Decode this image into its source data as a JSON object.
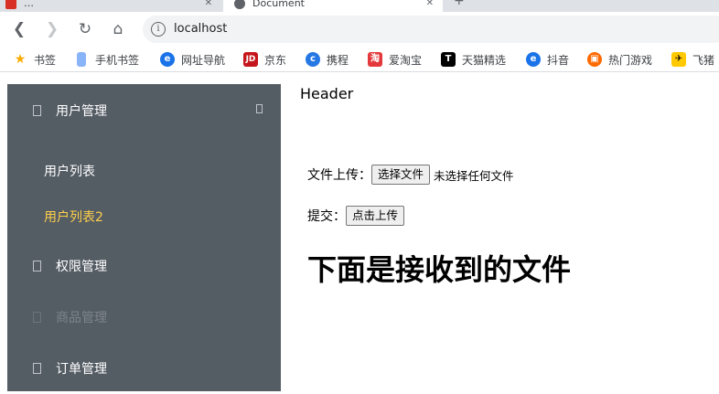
{
  "browser": {
    "tabs": [
      {
        "title": "…"
      },
      {
        "title": "Document"
      }
    ],
    "omnibox": {
      "url": "localhost"
    },
    "bookmarks": [
      {
        "label": "书签",
        "icon": "star-icon",
        "color": "#f9ab00"
      },
      {
        "label": "手机书签",
        "icon": "phone-icon",
        "color": "#8ab4f8"
      },
      {
        "label": "网址导航",
        "icon": "e-browser-icon",
        "color": "#1a73e8"
      },
      {
        "label": "京东",
        "icon": "jd-logo-icon",
        "color": "#c4161c"
      },
      {
        "label": "携程",
        "icon": "ctrip-logo-icon",
        "color": "#2577e3"
      },
      {
        "label": "爱淘宝",
        "icon": "taobao-logo-icon",
        "color": "#e4393c"
      },
      {
        "label": "天猫精选",
        "icon": "tmall-logo-icon",
        "color": "#000000"
      },
      {
        "label": "抖音",
        "icon": "e-browser-icon",
        "color": "#1a73e8"
      },
      {
        "label": "热门游戏",
        "icon": "game-icon",
        "color": "#ff6a00"
      },
      {
        "label": "飞猪",
        "icon": "fliggy-logo-icon",
        "color": "#ffc900"
      }
    ]
  },
  "page": {
    "header": "Header",
    "menu": {
      "user_mgmt": "用户管理",
      "user_list": "用户列表",
      "user_list2": "用户列表2",
      "permission_mgmt": "权限管理",
      "goods_mgmt": "商品管理",
      "order_mgmt": "订单管理"
    },
    "menu_colors": {
      "background": "#545c64",
      "active_text": "#ffd04b",
      "text": "#ffffff"
    },
    "upload": {
      "label": "文件上传：",
      "choose_button": "选择文件",
      "no_file": "未选择任何文件"
    },
    "submit": {
      "label": "提交：",
      "button": "点击上传"
    },
    "received_heading": "下面是接收到的文件"
  }
}
